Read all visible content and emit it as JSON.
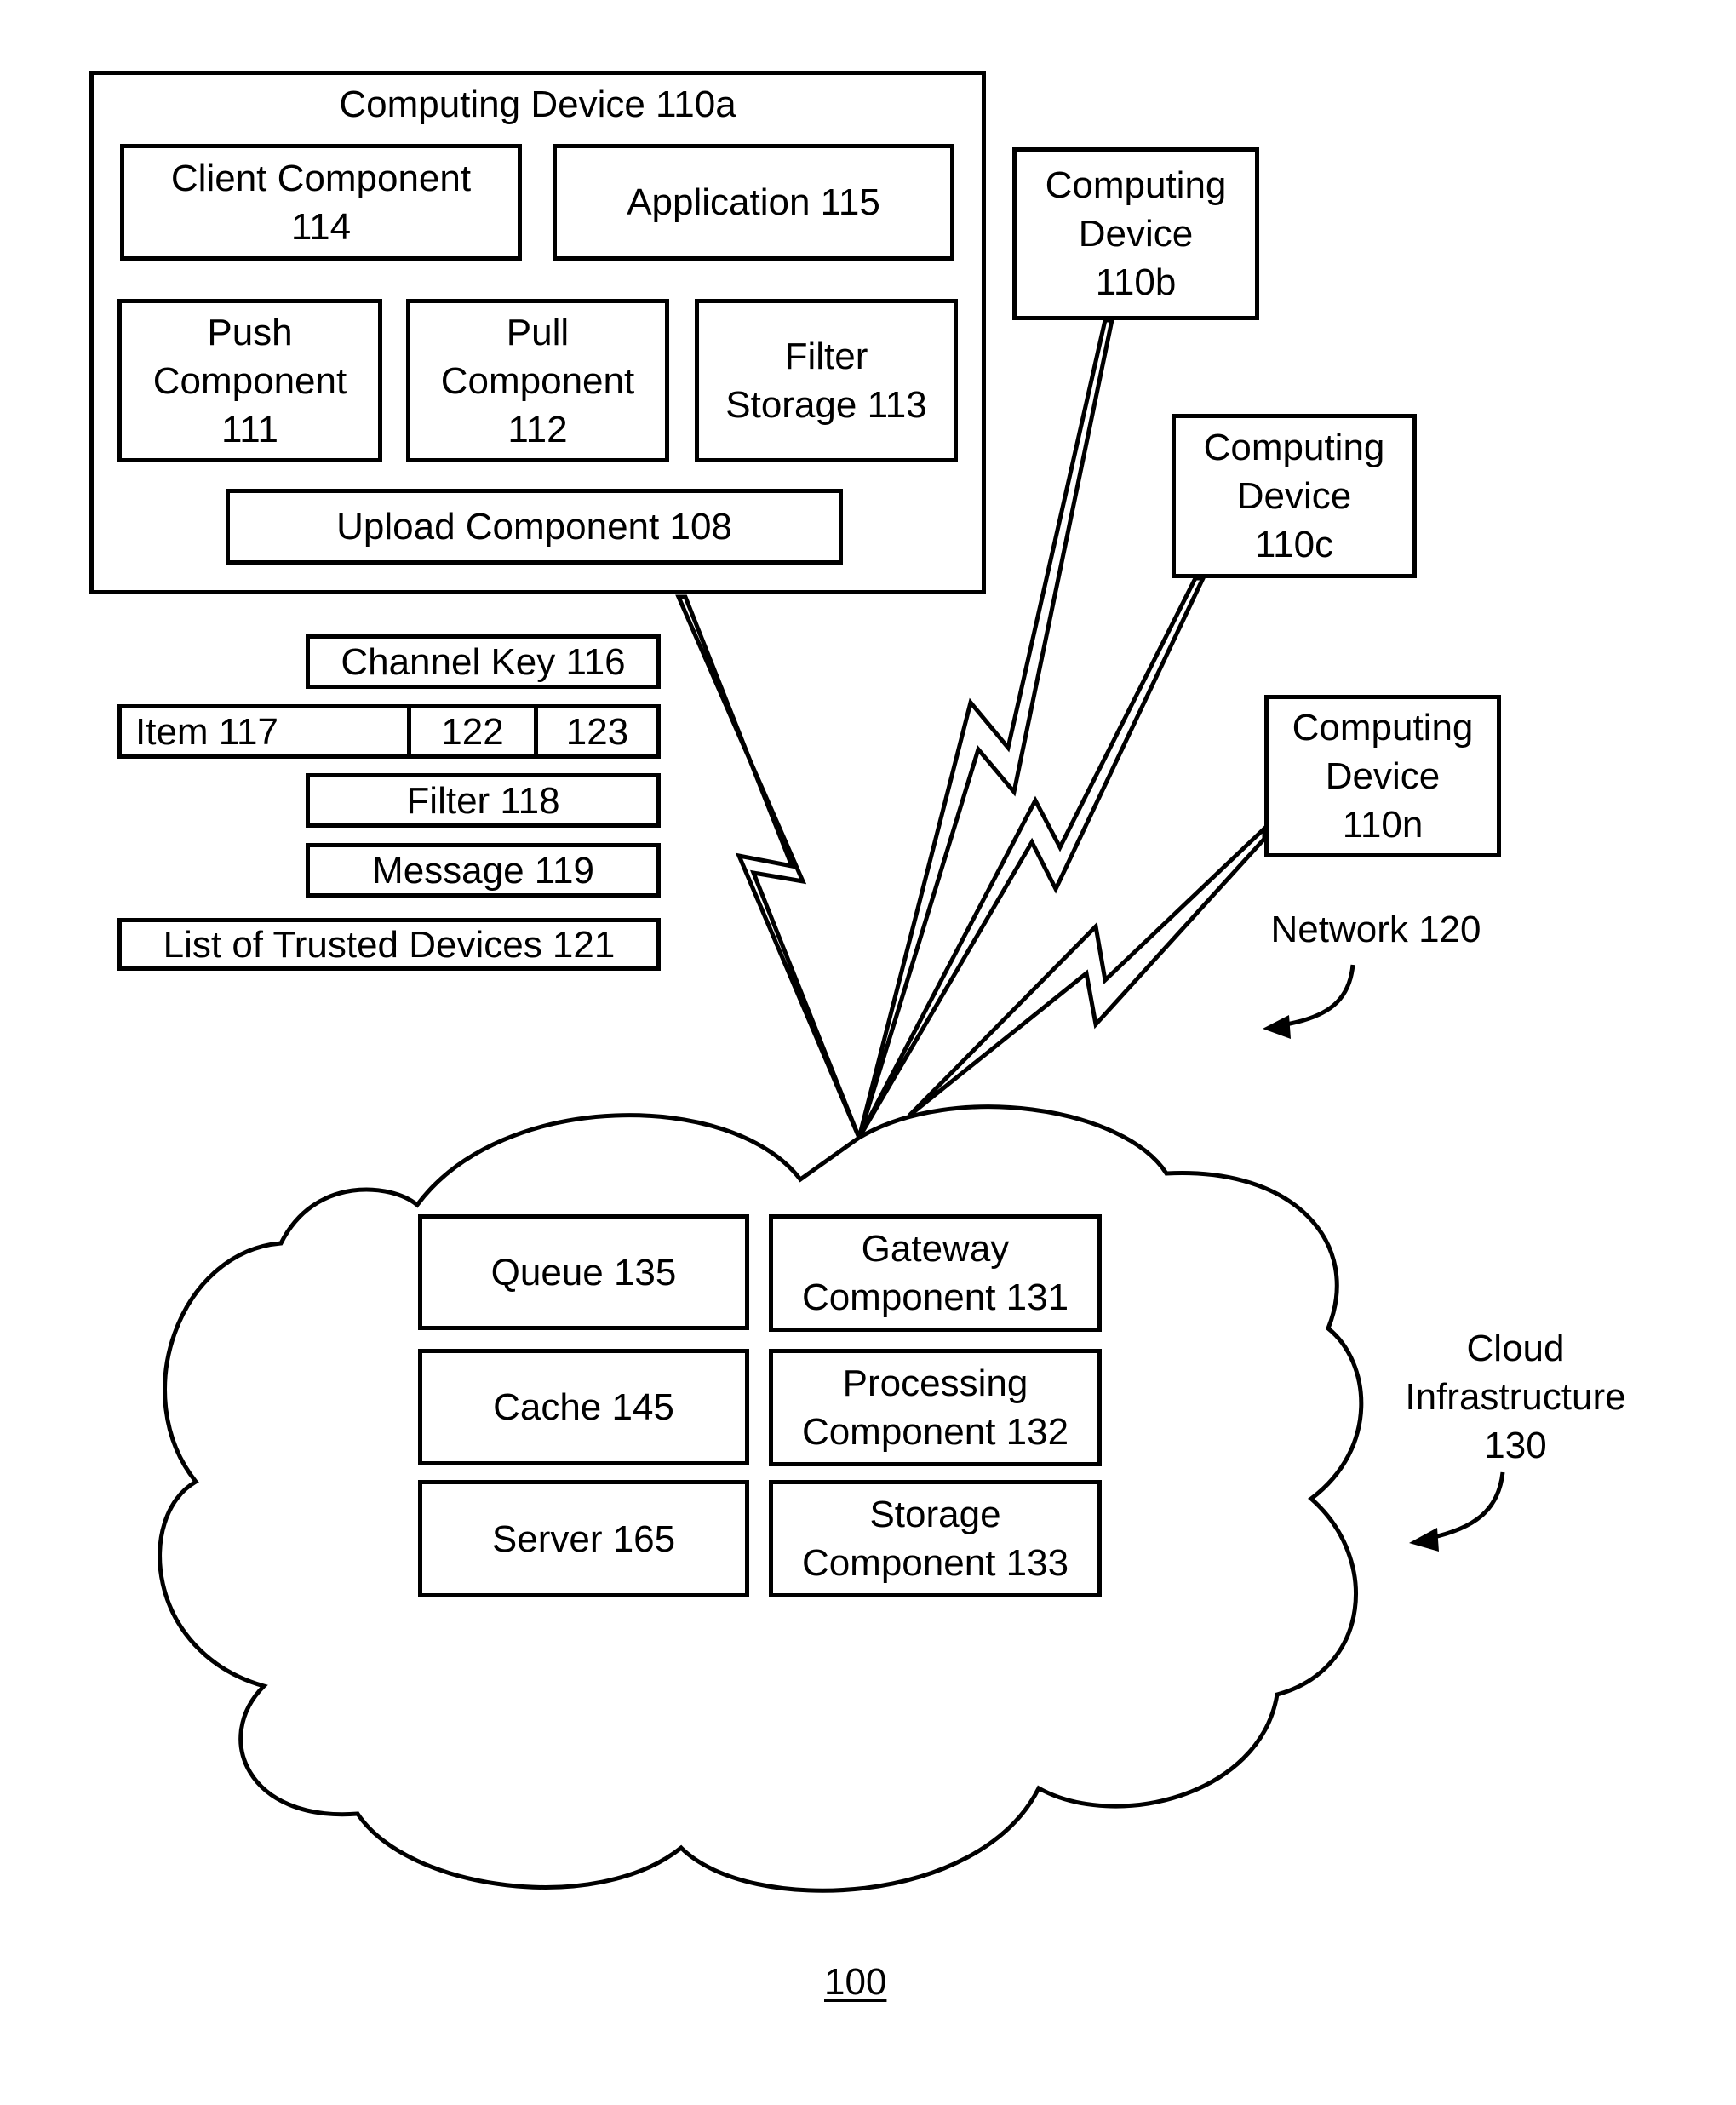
{
  "figure_number": "100",
  "computing_device_a": {
    "title": "Computing Device 110a",
    "components": {
      "client": "Client Component\n114",
      "application": "Application 115",
      "push": "Push\nComponent\n111",
      "pull": "Pull\nComponent\n112",
      "filter_storage": "Filter\nStorage 113",
      "upload": "Upload Component 108"
    }
  },
  "data_items": {
    "channel_key": "Channel Key 116",
    "item": "Item 117",
    "item_field_1": "122",
    "item_field_2": "123",
    "filter": "Filter 118",
    "message": "Message 119",
    "trusted_devices": "List of Trusted Devices 121"
  },
  "other_devices": [
    {
      "label": "Computing\nDevice\n110b"
    },
    {
      "label": "Computing\nDevice\n110c"
    },
    {
      "label": "Computing\nDevice\n110n"
    }
  ],
  "network": {
    "label": "Network 120"
  },
  "cloud": {
    "label": "Cloud\nInfrastructure\n130",
    "components": [
      "Queue 135",
      "Gateway\nComponent 131",
      "Cache 145",
      "Processing\nComponent 132",
      "Server 165",
      "Storage\nComponent 133"
    ]
  }
}
